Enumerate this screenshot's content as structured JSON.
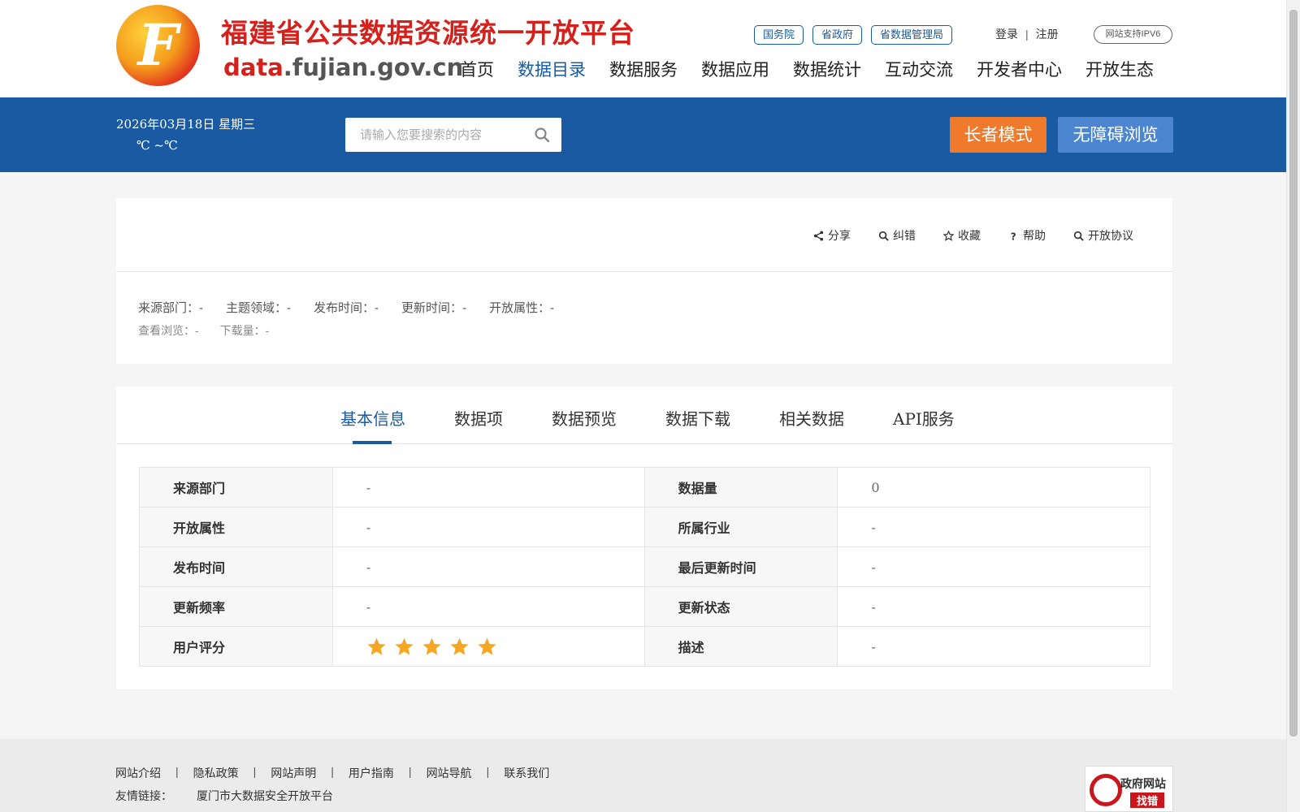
{
  "header": {
    "site_title": "福建省公共数据资源统一开放平台",
    "site_domain_prefix": "data",
    "site_domain_suffix": ".fujian.gov.cn",
    "logo_letter": "F",
    "gov_links": [
      "国务院",
      "省政府",
      "省数据管理局"
    ],
    "login_label": "登录",
    "auth_separator": "|",
    "register_label": "注册",
    "ipv6_label": "网站支持IPV6",
    "nav": [
      "首页",
      "数据目录",
      "数据服务",
      "数据应用",
      "数据统计",
      "互动交流",
      "开发者中心",
      "开放生态"
    ],
    "active_nav": "数据目录"
  },
  "bluebar": {
    "date": "2026年03月18日   星期三",
    "temperature": "℃ ~℃",
    "search_placeholder": "请输入您要搜索的内容",
    "elder_mode_label": "长者模式",
    "accessibility_label": "无障碍浏览"
  },
  "detail": {
    "actions": [
      {
        "label": "分享",
        "icon": "share-icon"
      },
      {
        "label": "纠错",
        "icon": "search-icon"
      },
      {
        "label": "收藏",
        "icon": "star-outline-icon"
      },
      {
        "label": "帮助",
        "icon": "question-icon"
      },
      {
        "label": "开放协议",
        "icon": "search-icon"
      }
    ],
    "meta_row1": [
      {
        "label": "来源部门：",
        "value": "-"
      },
      {
        "label": "主题领域：",
        "value": "-"
      },
      {
        "label": "发布时间：",
        "value": "-"
      },
      {
        "label": "更新时间：",
        "value": "-"
      },
      {
        "label": "开放属性：",
        "value": "-"
      }
    ],
    "meta_row2": [
      {
        "label": "查看浏览：",
        "value": "-"
      },
      {
        "label": "下载量：",
        "value": "-"
      }
    ]
  },
  "tabs": {
    "items": [
      "基本信息",
      "数据项",
      "数据预览",
      "数据下载",
      "相关数据",
      "API服务"
    ],
    "active": "基本信息"
  },
  "info_table": {
    "rows": [
      {
        "l1": "来源部门",
        "v1": "-",
        "l2": "数据量",
        "v2": "0"
      },
      {
        "l1": "开放属性",
        "v1": "-",
        "l2": "所属行业",
        "v2": "-"
      },
      {
        "l1": "发布时间",
        "v1": "-",
        "l2": "最后更新时间",
        "v2": "-"
      },
      {
        "l1": "更新频率",
        "v1": "-",
        "l2": "更新状态",
        "v2": "-"
      },
      {
        "l1": "用户评分",
        "v1": "",
        "l2": "描述",
        "v2": "-"
      }
    ],
    "user_rating_stars": 5,
    "star_color": "#f5a623"
  },
  "footer": {
    "links": [
      "网站介绍",
      "隐私政策",
      "网站声明",
      "用户指南",
      "网站导航",
      "联系我们"
    ],
    "link_separator": "|",
    "friend_label": "友情链接：",
    "friend_links": [
      "厦门市大数据安全开放平台"
    ],
    "govfix_line1": "政府网站",
    "govfix_line2": "找错"
  },
  "colors": {
    "brand_blue": "#1a5aa3",
    "brand_red": "#d6201c",
    "elder_orange": "#f07a2c",
    "access_blue": "#4c86d1"
  }
}
